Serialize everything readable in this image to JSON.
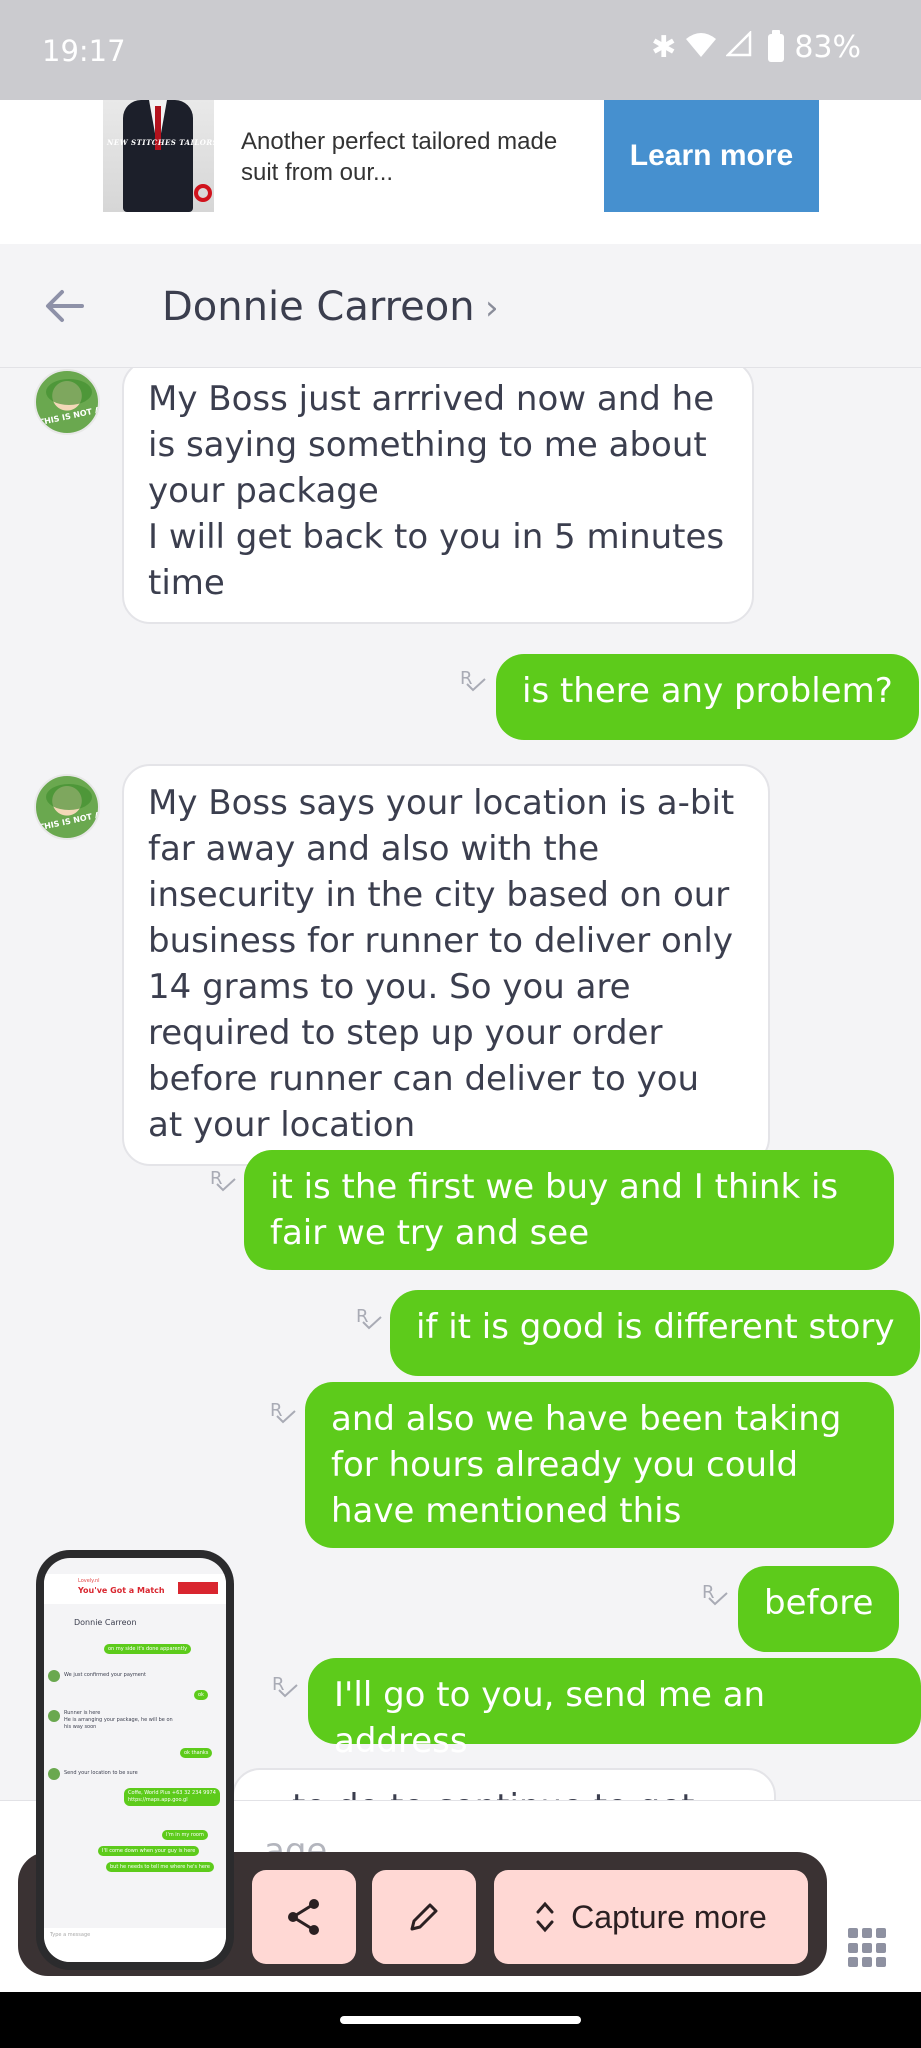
{
  "status_bar": {
    "time": "19:17",
    "battery": "83%"
  },
  "ad": {
    "brand": "NEW STITCHES TAILORS",
    "text": "Another perfect tailored made suit from our...",
    "cta": "Learn more"
  },
  "header": {
    "contact_name": "Donnie Carreon"
  },
  "messages": [
    {
      "dir": "in",
      "text": "My Boss just arrrived now and he is saying something to me about your package\nI will get back to you in 5 minutes time"
    },
    {
      "dir": "out",
      "text": "is there any problem?"
    },
    {
      "dir": "in",
      "text": "My Boss says your location is a-bit far away and also with the insecurity in the city based on our business for runner to deliver only 14 grams to you. So you are required to step up your order  before runner can deliver to you at your location"
    },
    {
      "dir": "out",
      "text": "it is the first we buy and I think is fair we try and see"
    },
    {
      "dir": "out",
      "text": "if it is good is different story"
    },
    {
      "dir": "out",
      "text": "and also we have been taking for hours already you could have mentioned this"
    },
    {
      "dir": "out",
      "text": "before"
    },
    {
      "dir": "out",
      "text": "I'll go to you, send me an address"
    },
    {
      "dir": "in",
      "text": "…to do to continue to get the…"
    }
  ],
  "read_marker": "R",
  "avatar_caption": "THIS IS NOT A DOLL",
  "input": {
    "placeholder": "…age"
  },
  "capture_toolbar": {
    "capture_more_label": "Capture more"
  },
  "thumbnail": {
    "ad_line1": "Lovely.nl",
    "ad_title": "You've Got a Match",
    "contact": "Donnie Carreon",
    "lines_out": [
      "on my side it's done apparently",
      "ok",
      "ok thanks",
      "Coffe, World Plus +63 32 234 9974 https://maps.app.goo.gl",
      "I'm in my room",
      "I'll come down when your guy is here",
      "but he needs to tell me where he's here"
    ],
    "lines_in": [
      "We just confirmed your payment",
      "Runner is here\nHe is arranging your package, he will be on his way soon",
      "Send your location to be sure"
    ],
    "input_placeholder": "Type a message"
  }
}
